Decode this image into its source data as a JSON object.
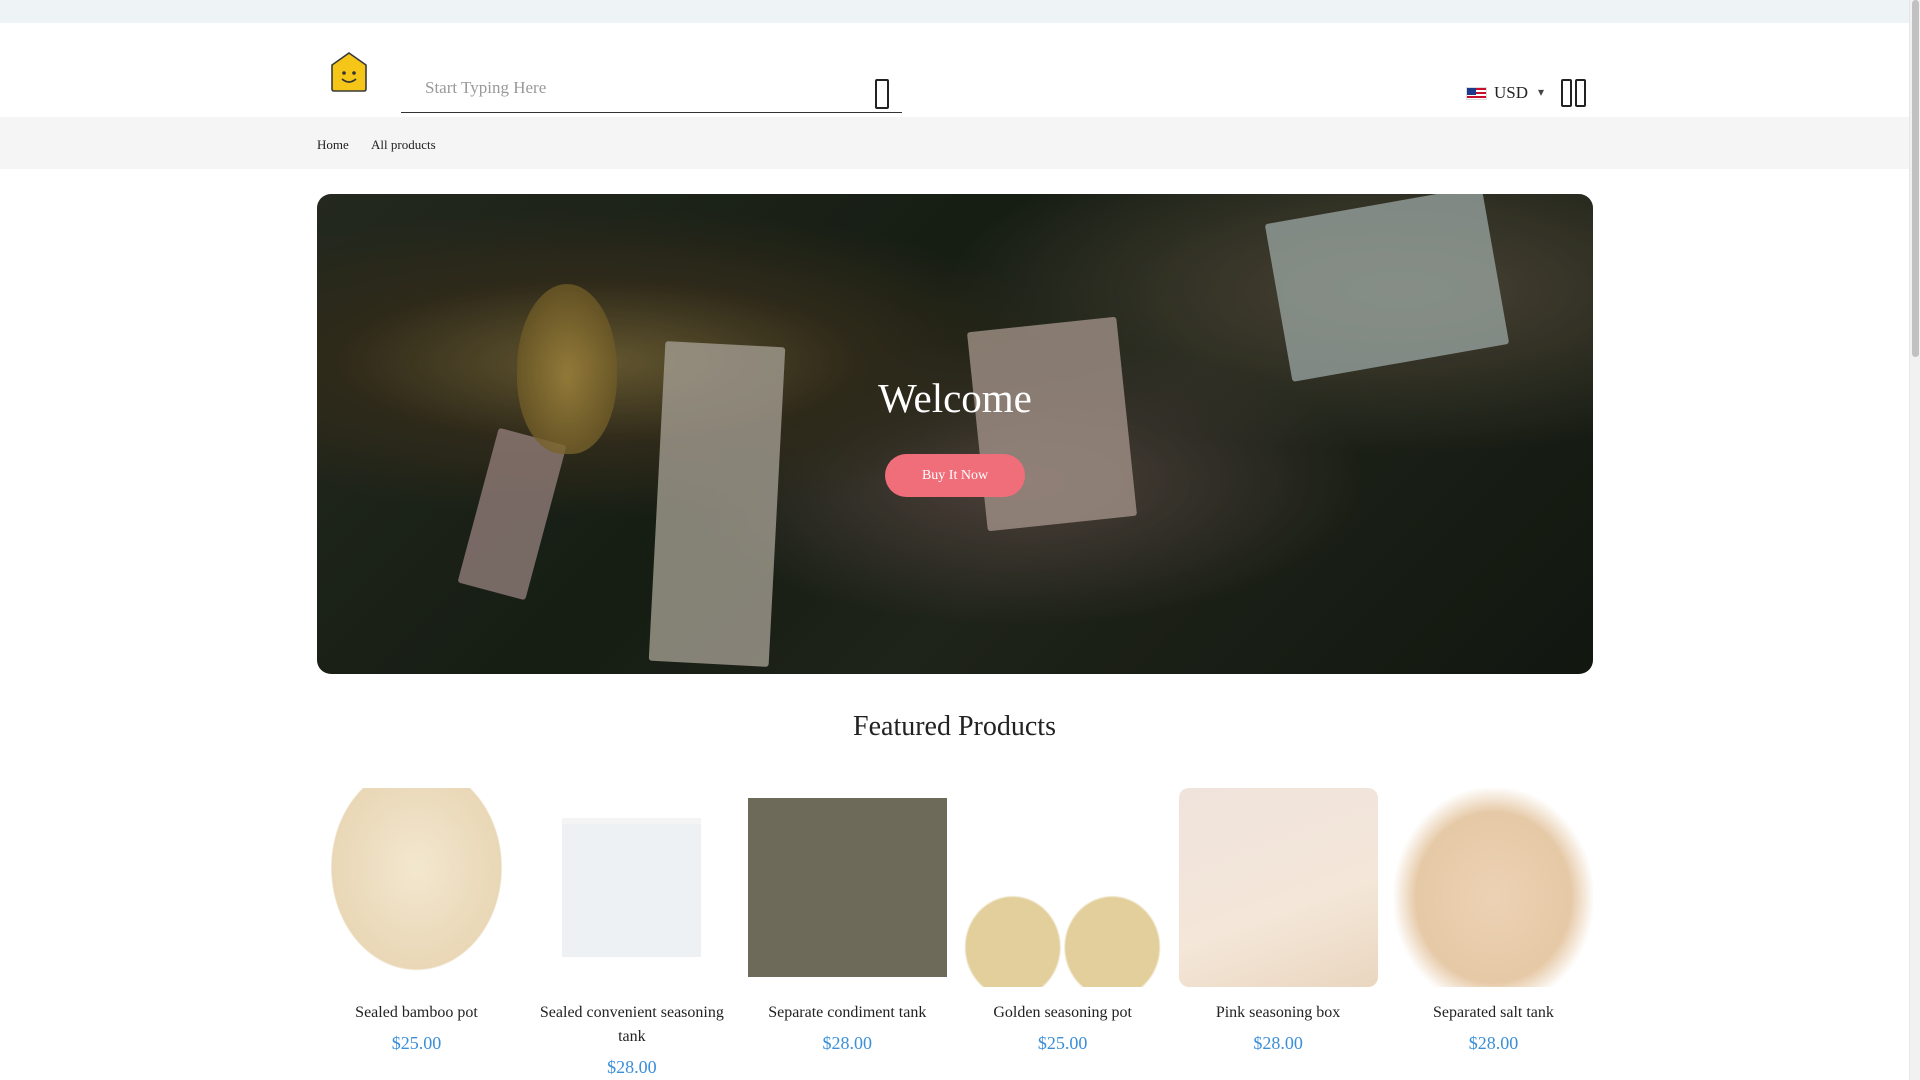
{
  "header": {
    "search_placeholder": "Start Typing Here",
    "currency": "USD",
    "caret": "▾"
  },
  "breadcrumb": {
    "home": "Home",
    "current": "All products"
  },
  "hero": {
    "title": "Welcome",
    "button": "Buy It Now"
  },
  "featured": {
    "title": "Featured Products",
    "products": [
      {
        "name": "Sealed bamboo pot",
        "price": "$25.00"
      },
      {
        "name": "Sealed convenient seasoning tank",
        "price": "$28.00"
      },
      {
        "name": "Separate condiment tank",
        "price": "$28.00"
      },
      {
        "name": "Golden seasoning pot",
        "price": "$25.00"
      },
      {
        "name": "Pink seasoning box",
        "price": "$28.00"
      },
      {
        "name": "Separated salt tank",
        "price": "$28.00"
      }
    ]
  },
  "colors": {
    "accent_button": "#f06e7a",
    "price": "#3b8fd9",
    "logo_yellow": "#f5c518"
  }
}
